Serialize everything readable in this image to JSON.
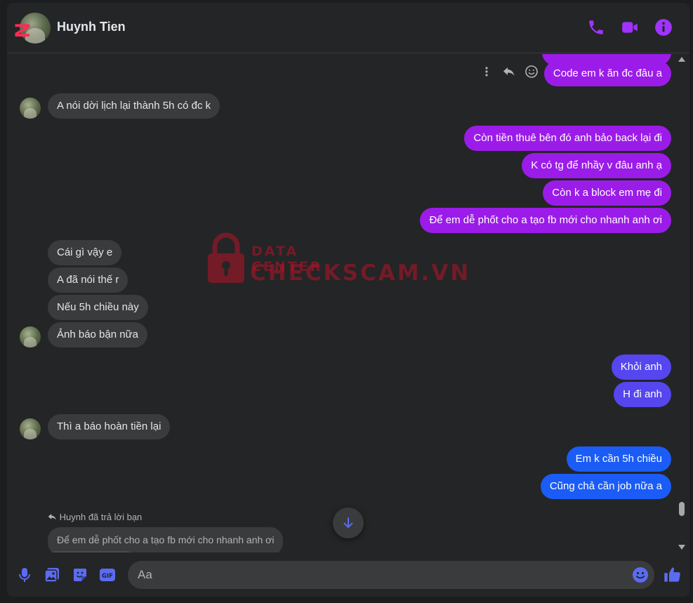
{
  "header": {
    "contact_name": "Huynh Tien",
    "corner_logo_text": "N"
  },
  "colors": {
    "accent": "#a033ff",
    "incoming_bubble": "#3a3b3c",
    "outgoing_purple": "#9b1ce8",
    "outgoing_violet": "#5546f0",
    "outgoing_blue": "#1a5cf5"
  },
  "icons": {
    "call": "phone-icon",
    "video": "video-camera-icon",
    "info": "info-icon",
    "more": "more-vertical-icon",
    "reply": "reply-icon",
    "react": "smiley-icon",
    "scroll_down": "arrow-down-icon",
    "mic": "microphone-icon",
    "photo": "photo-icon",
    "sticker": "sticker-icon",
    "gif": "gif-icon",
    "emoji": "emoji-icon",
    "like": "thumbs-up-icon"
  },
  "messages": [
    {
      "from": "me",
      "text": "Code em k ăn đc đâu a"
    },
    {
      "from": "them",
      "text": "A nói dời lịch lại thành 5h có đc k"
    },
    {
      "from": "me",
      "text": "Còn tiền thuê bên đó anh bảo back lại đi"
    },
    {
      "from": "me",
      "text": "K có tg để nhầy v đâu anh ạ"
    },
    {
      "from": "me",
      "text": "Còn k a block em mẹ đi"
    },
    {
      "from": "me",
      "text": "Để em dễ phốt cho a tạo fb mới cho nhanh anh ơi"
    },
    {
      "from": "them",
      "text": "Cái gì vậy e"
    },
    {
      "from": "them",
      "text": "A đã nói thế r"
    },
    {
      "from": "them",
      "text": "Nếu 5h chiều này"
    },
    {
      "from": "them",
      "text": "Ảnh báo bận nữa"
    },
    {
      "from": "me",
      "text": "Khỏi anh"
    },
    {
      "from": "me",
      "text": "H đi anh"
    },
    {
      "from": "them",
      "text": "Thì a báo hoàn tiền lại"
    },
    {
      "from": "me",
      "text": "Em k cần 5h chiều"
    },
    {
      "from": "me",
      "text": "Cũng chả cần job nữa a"
    }
  ],
  "reply": {
    "note": "Huynh đã trả lời bạn",
    "quoted": "Để em dễ phốt cho a tạo fb mới cho nhanh anh ơi"
  },
  "watermark": {
    "small": "DATA CENTER",
    "big": "CHECKSCAM.VN"
  },
  "composer": {
    "placeholder": "Aa"
  }
}
